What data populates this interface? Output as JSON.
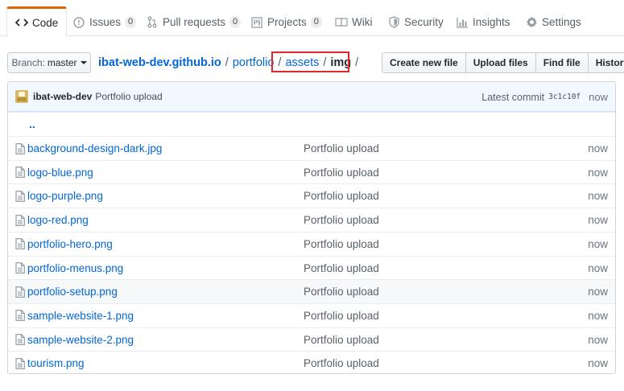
{
  "tabs": [
    {
      "id": "code",
      "label": "Code",
      "icon": "code-icon",
      "selected": true
    },
    {
      "id": "issues",
      "label": "Issues",
      "icon": "issue-icon",
      "count": "0"
    },
    {
      "id": "pulls",
      "label": "Pull requests",
      "icon": "pull-request-icon",
      "count": "0"
    },
    {
      "id": "projects",
      "label": "Projects",
      "icon": "project-icon",
      "count": "0"
    },
    {
      "id": "wiki",
      "label": "Wiki",
      "icon": "book-icon"
    },
    {
      "id": "security",
      "label": "Security",
      "icon": "shield-icon"
    },
    {
      "id": "insights",
      "label": "Insights",
      "icon": "graph-icon"
    },
    {
      "id": "settings",
      "label": "Settings",
      "icon": "gear-icon"
    }
  ],
  "branch": {
    "label": "Branch:",
    "value": "master"
  },
  "breadcrumb": {
    "root": "ibat-web-dev.github.io",
    "parts": [
      "portfolio",
      "assets"
    ],
    "current": "img",
    "separator": "/"
  },
  "actions": {
    "create": "Create new file",
    "upload": "Upload files",
    "find": "Find file",
    "history": "History"
  },
  "commit": {
    "author": "ibat-web-dev",
    "message": "Portfolio upload",
    "latest_label": "Latest commit",
    "sha": "3c1c10f",
    "age": "now"
  },
  "updir": "..",
  "files": [
    {
      "name": "background-design-dark.jpg",
      "message": "Portfolio upload",
      "age": "now"
    },
    {
      "name": "logo-blue.png",
      "message": "Portfolio upload",
      "age": "now"
    },
    {
      "name": "logo-purple.png",
      "message": "Portfolio upload",
      "age": "now"
    },
    {
      "name": "logo-red.png",
      "message": "Portfolio upload",
      "age": "now"
    },
    {
      "name": "portfolio-hero.png",
      "message": "Portfolio upload",
      "age": "now"
    },
    {
      "name": "portfolio-menus.png",
      "message": "Portfolio upload",
      "age": "now"
    },
    {
      "name": "portfolio-setup.png",
      "message": "Portfolio upload",
      "age": "now"
    },
    {
      "name": "sample-website-1.png",
      "message": "Portfolio upload",
      "age": "now"
    },
    {
      "name": "sample-website-2.png",
      "message": "Portfolio upload",
      "age": "now"
    },
    {
      "name": "tourism.png",
      "message": "Portfolio upload",
      "age": "now"
    }
  ],
  "colors": {
    "link": "#0366d6",
    "tab_accent": "#e36209",
    "highlight": "#e4272c"
  }
}
